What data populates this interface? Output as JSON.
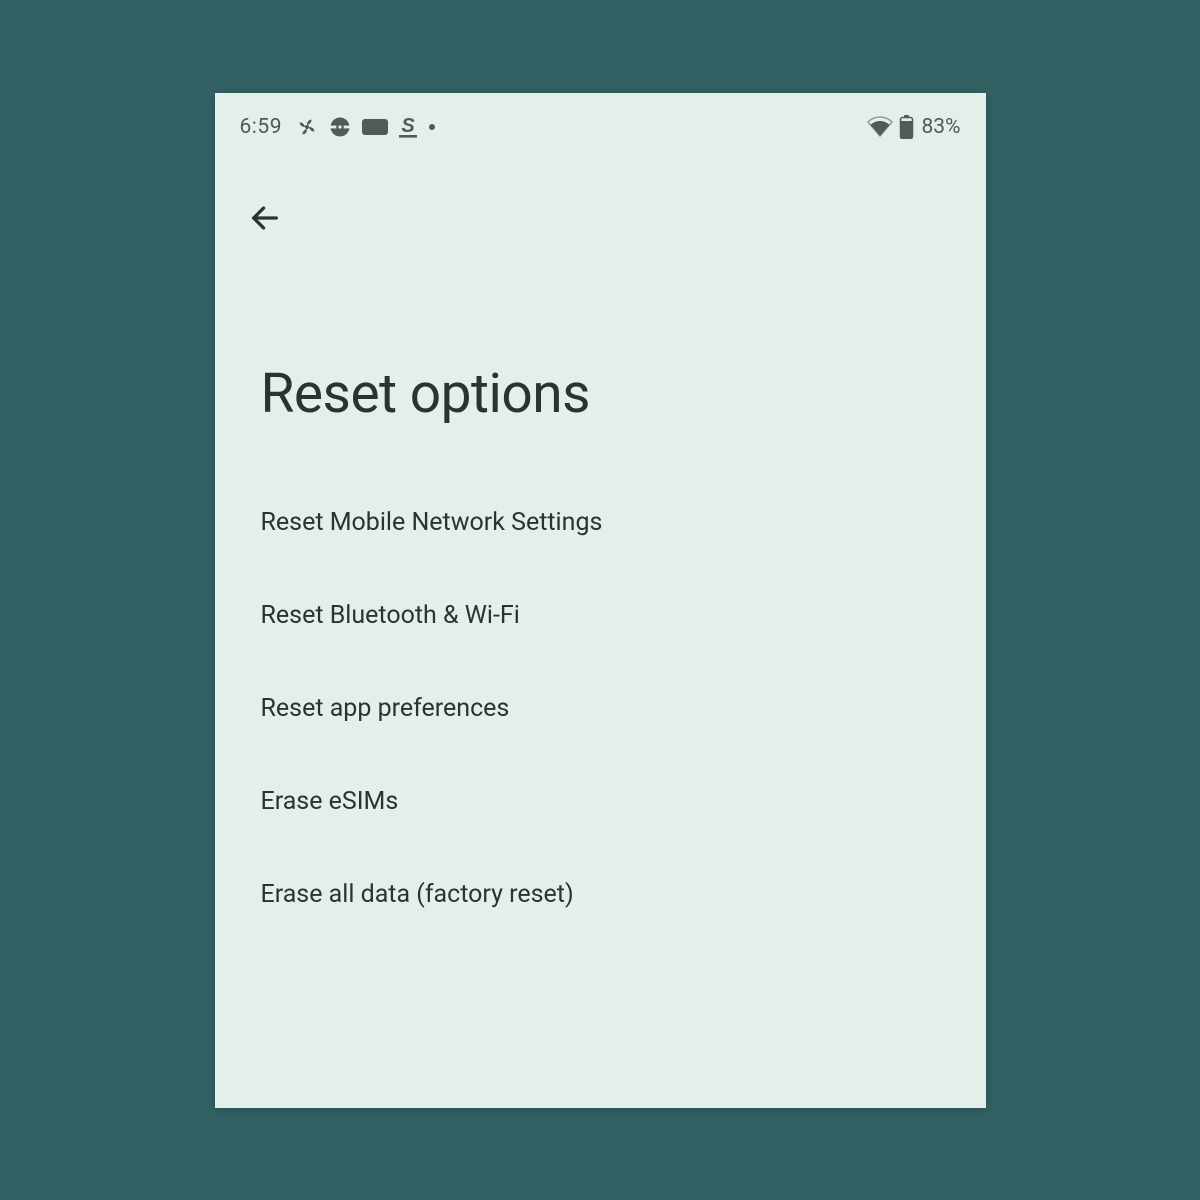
{
  "status_bar": {
    "time": "6:59",
    "battery_percent": "83%",
    "icons_left": [
      "fan-icon",
      "pokeball-icon",
      "rectangle-icon",
      "s-icon",
      "dot-icon"
    ],
    "icons_right": [
      "wifi-icon",
      "battery-icon"
    ]
  },
  "header": {
    "title": "Reset options"
  },
  "options": [
    {
      "label": "Reset Mobile Network Settings"
    },
    {
      "label": "Reset Bluetooth & Wi-Fi"
    },
    {
      "label": "Reset app preferences"
    },
    {
      "label": "Erase eSIMs"
    },
    {
      "label": "Erase all data (factory reset)"
    }
  ],
  "colors": {
    "background": "#326063",
    "panel": "#e3efe8",
    "text_primary": "#2b3330",
    "text_muted": "#4f5b55"
  }
}
